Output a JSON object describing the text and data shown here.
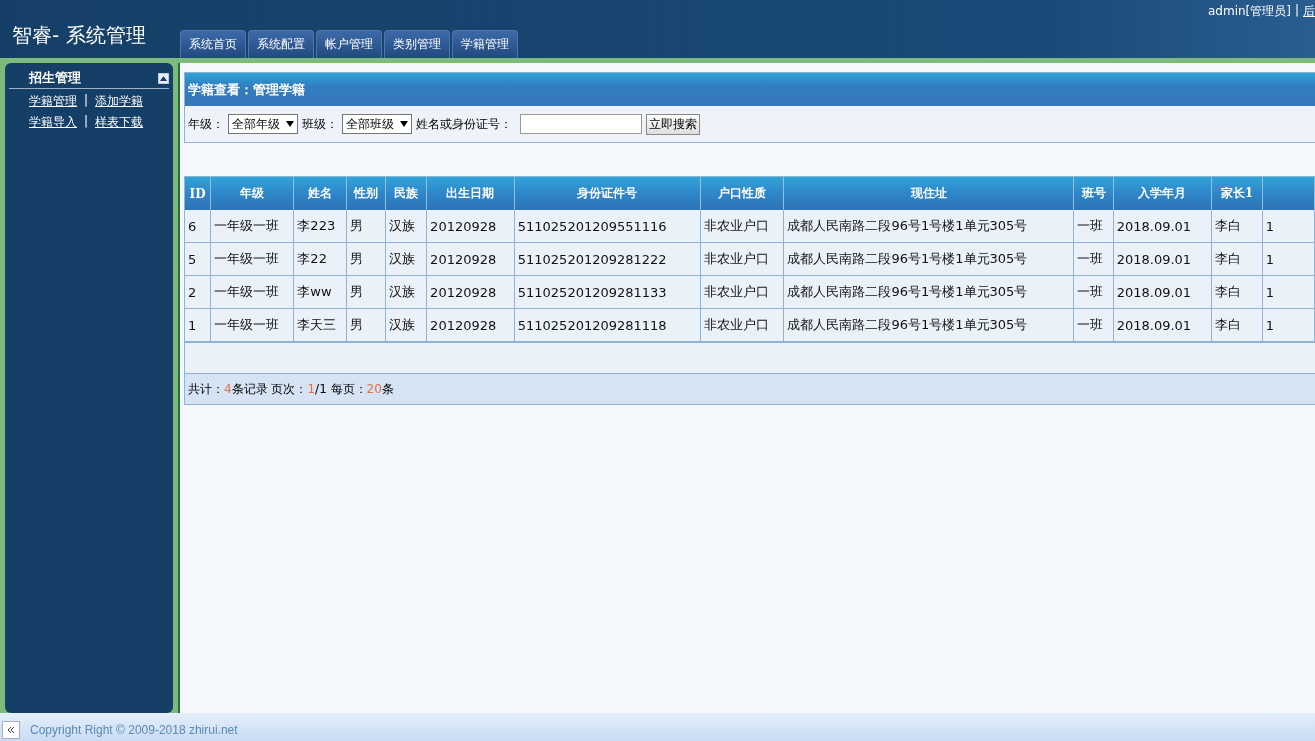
{
  "header": {
    "title": "智睿- 系统管理",
    "user": "admin[管理员]",
    "separator": "|",
    "link": "后"
  },
  "tabs": [
    {
      "label": "系统首页",
      "selected": false
    },
    {
      "label": "系统配置",
      "selected": false
    },
    {
      "label": "帐户管理",
      "selected": false
    },
    {
      "label": "类别管理",
      "selected": false
    },
    {
      "label": "学籍管理",
      "selected": false
    }
  ],
  "sidebar": {
    "title": "招生管理",
    "expanded": true,
    "link_rows": [
      [
        "学籍管理",
        "添加学籍"
      ],
      [
        "学籍导入",
        "样表下载"
      ]
    ],
    "separator": "|"
  },
  "panel": {
    "title": "学籍查看：管理学籍",
    "filters": {
      "grade_label": "年级：",
      "grade_value": "全部年级",
      "class_label": "班级：",
      "class_value": "全部班级",
      "search_label": "姓名或身份证号：",
      "search_button": "立即搜索"
    },
    "table": {
      "columns": [
        "ID",
        "年级",
        "姓名",
        "性别",
        "民族",
        "出生日期",
        "身份证件号",
        "户口性质",
        "现住址",
        "班号",
        "入学年月",
        "家长1"
      ],
      "rows": [
        [
          "6",
          "一年级一班",
          "李223",
          "男",
          "汉族",
          "20120928",
          "511025201209551116",
          "非农业户口",
          "成都人民南路二段96号1号楼1单元305号",
          "一班",
          "2018.09.01",
          "李白",
          "1"
        ],
        [
          "5",
          "一年级一班",
          "李22",
          "男",
          "汉族",
          "20120928",
          "511025201209281222",
          "非农业户口",
          "成都人民南路二段96号1号楼1单元305号",
          "一班",
          "2018.09.01",
          "李白",
          "1"
        ],
        [
          "2",
          "一年级一班",
          "李ww",
          "男",
          "汉族",
          "20120928",
          "511025201209281133",
          "非农业户口",
          "成都人民南路二段96号1号楼1单元305号",
          "一班",
          "2018.09.01",
          "李白",
          "1"
        ],
        [
          "1",
          "一年级一班",
          "李天三",
          "男",
          "汉族",
          "20120928",
          "511025201209281118",
          "非农业户口",
          "成都人民南路二段96号1号楼1单元305号",
          "一班",
          "2018.09.01",
          "李白",
          "1"
        ]
      ]
    },
    "pager": [
      {
        "text": "共计：",
        "highlight": false
      },
      {
        "text": "4",
        "highlight": true
      },
      {
        "text": "条记录 页次：",
        "highlight": false
      },
      {
        "text": "1",
        "highlight": true
      },
      {
        "text": "/1 每页：",
        "highlight": false
      },
      {
        "text": "20",
        "highlight": true
      },
      {
        "text": "条",
        "highlight": false
      }
    ]
  },
  "footer": {
    "copyright": "Copyright Right © 2009-2018 zhirui.net"
  }
}
